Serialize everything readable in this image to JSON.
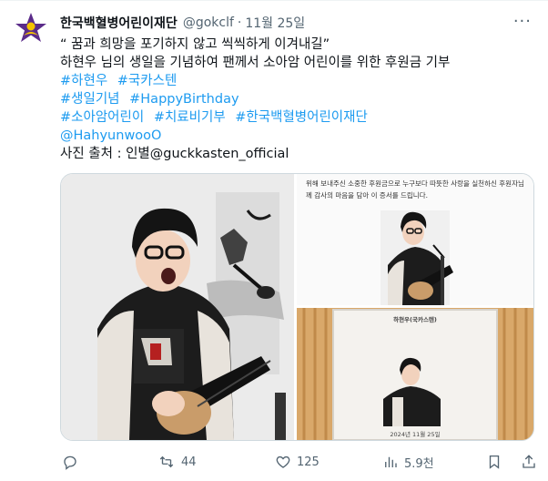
{
  "post": {
    "display_name": "한국백혈병어린이재단",
    "handle": "@gokclf",
    "separator": "·",
    "time": "11월 25일",
    "more_label": "···",
    "lines": {
      "l1": "“ 꿈과 희망을 포기하지 않고 씩씩하게 이겨내길”",
      "l2": "하현우 님의 생일을 기념하여 팬께서 소아암 어린이를 위한 후원금 기부",
      "l7": "사진 출처 : 인별@guckkasten_official"
    },
    "hashtags": {
      "h1": "#하현우",
      "h2": "#국카스텐",
      "h3": "#생일기념",
      "h4": "#HappyBirthday",
      "h5": "#소아암어린이",
      "h6": "#치료비기부",
      "h7": "#한국백혈병어린이재단"
    },
    "mention": "@HahyunwooO"
  },
  "media": {
    "certificate_text": "위해 보내주신 소중한 후원금으로 누구보다 따뜻한 사랑을 실천하신 후원자님께 감사의 마음을 담아 이 증서를 드립니다.",
    "certificate_name": "하현우(국카스텐)",
    "certificate_date": "2024년 11월 25일"
  },
  "actions": {
    "reply_count": "",
    "retweet_count": "44",
    "like_count": "125",
    "view_count": "5.9천"
  },
  "colors": {
    "accent": "#1d9bf0",
    "text": "#0f1419",
    "muted": "#536471",
    "logo": "#5b2c8a"
  }
}
